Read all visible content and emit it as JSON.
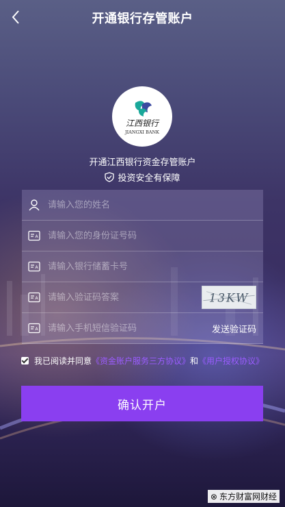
{
  "header": {
    "title": "开通银行存管账户",
    "back_icon": "chevron-left-icon"
  },
  "logo": {
    "bank_name_cn": "江西银行",
    "bank_name_en": "JIANGXI BANK"
  },
  "subtitle": "开通江西银行资金存管账户",
  "security": {
    "icon": "shield-check-icon",
    "text": "投资安全有保障"
  },
  "form": {
    "name_placeholder": "请输入您的姓名",
    "id_placeholder": "请输入您的身份证号码",
    "card_placeholder": "请输入银行储蓄卡号",
    "captcha_placeholder": "请输入验证码答案",
    "captcha_text": "13KW",
    "sms_placeholder": "请输入手机短信验证码",
    "send_code_label": "发送验证码"
  },
  "agreement": {
    "checked": true,
    "prefix": "我已阅读并同意",
    "link1": "《资金账户服务三方协议》",
    "and": "和",
    "link2": "《用户授权协议》"
  },
  "submit_label": "确认开户",
  "watermark": "东方财富网财经",
  "colors": {
    "accent": "#8a3ff0",
    "link": "#9b5cff",
    "logo_teal": "#1aa89a"
  }
}
